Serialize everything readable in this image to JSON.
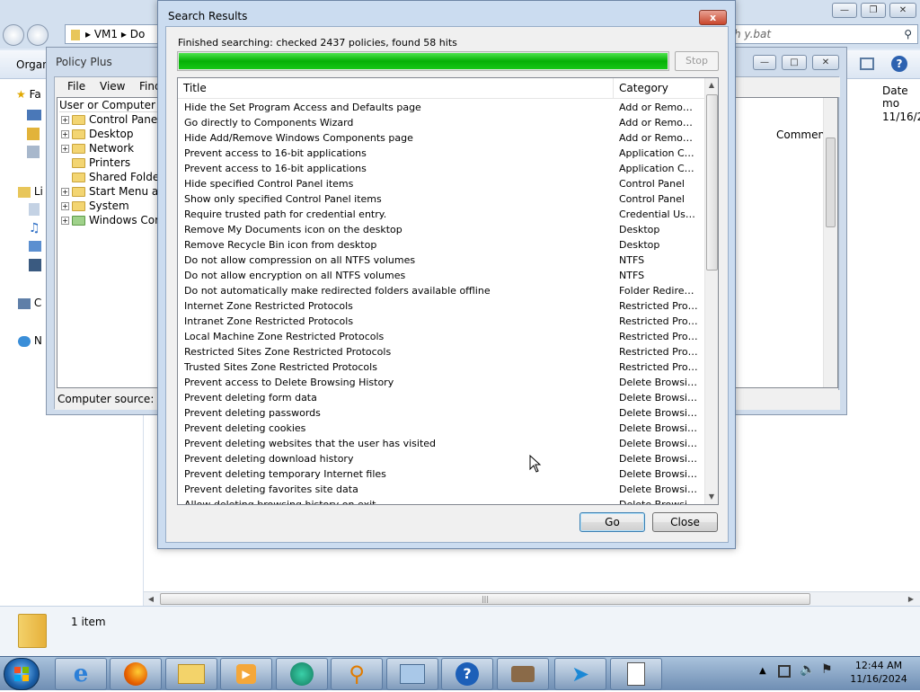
{
  "explorer": {
    "address_parts": [
      "VM1",
      "Do"
    ],
    "search_placeholder": "h y.bat",
    "organize_label": "Organ",
    "nav_items": [
      "Fa",
      "Li",
      "C",
      "N"
    ],
    "col_comment": "Comment",
    "col_date": "Date mo",
    "date_value": "11/16/2",
    "status_count": "1 item"
  },
  "policy_plus": {
    "title": "Policy Plus",
    "menu": [
      "File",
      "View",
      "Find"
    ],
    "tree_header": "User or Computer",
    "tree_items": [
      "Control Panel",
      "Desktop",
      "Network",
      "Printers",
      "Shared Folders",
      "Start Menu and",
      "System",
      "Windows Comp"
    ],
    "status_label": "Computer source:  Lo"
  },
  "dialog": {
    "title": "Search Results",
    "close_glyph": "x",
    "status": "Finished searching: checked 2437 policies, found 58 hits",
    "progress": 1.0,
    "stop_label": "Stop",
    "columns": [
      "Title",
      "Category"
    ],
    "rows": [
      {
        "title": "Hide the Set Program Access and Defaults page",
        "category": "Add or Remove ..."
      },
      {
        "title": "Go directly to Components Wizard",
        "category": "Add or Remove ..."
      },
      {
        "title": "Hide Add/Remove Windows Components page",
        "category": "Add or Remove ..."
      },
      {
        "title": "Prevent access to 16-bit applications",
        "category": "Application Com..."
      },
      {
        "title": "Prevent access to 16-bit applications",
        "category": "Application Com..."
      },
      {
        "title": "Hide specified Control Panel items",
        "category": "Control Panel"
      },
      {
        "title": "Show only specified Control Panel items",
        "category": "Control Panel"
      },
      {
        "title": "Require trusted path for credential entry.",
        "category": "Credential User I..."
      },
      {
        "title": "Remove My Documents icon on the desktop",
        "category": "Desktop"
      },
      {
        "title": "Remove Recycle Bin icon from desktop",
        "category": "Desktop"
      },
      {
        "title": "Do not allow compression on all NTFS volumes",
        "category": "NTFS"
      },
      {
        "title": "Do not allow encryption on all NTFS volumes",
        "category": "NTFS"
      },
      {
        "title": "Do not automatically make redirected folders available offline",
        "category": "Folder Redirection"
      },
      {
        "title": "Internet Zone Restricted Protocols",
        "category": "Restricted Proto..."
      },
      {
        "title": "Intranet Zone Restricted Protocols",
        "category": "Restricted Proto..."
      },
      {
        "title": "Local Machine Zone Restricted Protocols",
        "category": "Restricted Proto..."
      },
      {
        "title": "Restricted Sites Zone Restricted Protocols",
        "category": "Restricted Proto..."
      },
      {
        "title": "Trusted Sites Zone Restricted Protocols",
        "category": "Restricted Proto..."
      },
      {
        "title": "Prevent access to Delete Browsing History",
        "category": "Delete Browsing..."
      },
      {
        "title": "Prevent deleting form data",
        "category": "Delete Browsing..."
      },
      {
        "title": "Prevent deleting passwords",
        "category": "Delete Browsing..."
      },
      {
        "title": "Prevent deleting cookies",
        "category": "Delete Browsing..."
      },
      {
        "title": "Prevent deleting websites that the user has visited",
        "category": "Delete Browsing..."
      },
      {
        "title": "Prevent deleting download history",
        "category": "Delete Browsing..."
      },
      {
        "title": "Prevent deleting temporary Internet files",
        "category": "Delete Browsing..."
      },
      {
        "title": "Prevent deleting favorites site data",
        "category": "Delete Browsing..."
      },
      {
        "title": "Allow deleting browsing history on exit",
        "category": "Delete Browsing..."
      }
    ],
    "go_label": "Go",
    "close_label": "Close"
  },
  "taskbar": {
    "time": "12:44 AM",
    "date": "11/16/2024",
    "apps": [
      "internet-explorer",
      "firefox",
      "file-explorer",
      "media-player",
      "app-green",
      "search-magnifier",
      "control-panel",
      "help",
      "network-tool",
      "remote-arrow",
      "notepad"
    ]
  }
}
